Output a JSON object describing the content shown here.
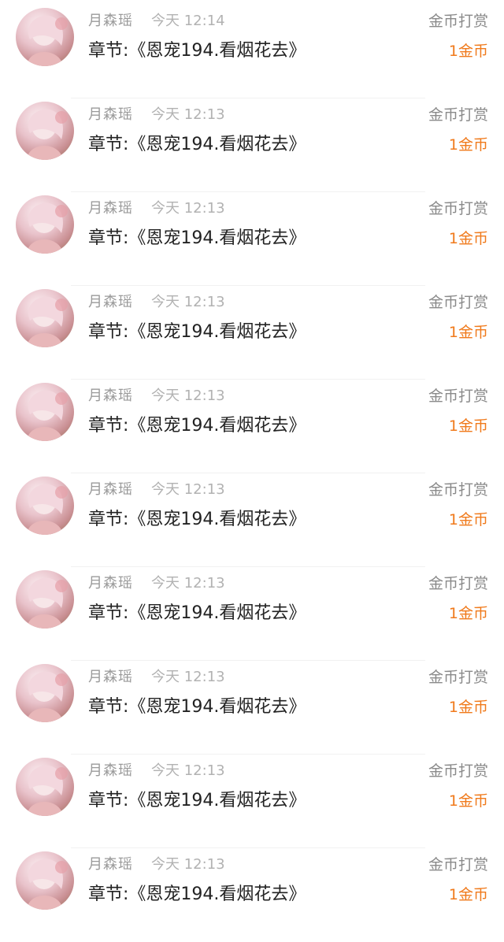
{
  "colors": {
    "name": "#9a9a9a",
    "time": "#b2b2b2",
    "chapter": "#222222",
    "type": "#8a8a8a",
    "amount": "#f07a1c"
  },
  "records": [
    {
      "user": "月森瑶",
      "time": "今天 12:14",
      "chapter": "章节:《恩宠194.看烟花去》",
      "type": "金币打赏",
      "amount": "1金币",
      "avatar_icon": "user-avatar-icon"
    },
    {
      "user": "月森瑶",
      "time": "今天 12:13",
      "chapter": "章节:《恩宠194.看烟花去》",
      "type": "金币打赏",
      "amount": "1金币",
      "avatar_icon": "user-avatar-icon"
    },
    {
      "user": "月森瑶",
      "time": "今天 12:13",
      "chapter": "章节:《恩宠194.看烟花去》",
      "type": "金币打赏",
      "amount": "1金币",
      "avatar_icon": "user-avatar-icon"
    },
    {
      "user": "月森瑶",
      "time": "今天 12:13",
      "chapter": "章节:《恩宠194.看烟花去》",
      "type": "金币打赏",
      "amount": "1金币",
      "avatar_icon": "user-avatar-icon"
    },
    {
      "user": "月森瑶",
      "time": "今天 12:13",
      "chapter": "章节:《恩宠194.看烟花去》",
      "type": "金币打赏",
      "amount": "1金币",
      "avatar_icon": "user-avatar-icon"
    },
    {
      "user": "月森瑶",
      "time": "今天 12:13",
      "chapter": "章节:《恩宠194.看烟花去》",
      "type": "金币打赏",
      "amount": "1金币",
      "avatar_icon": "user-avatar-icon"
    },
    {
      "user": "月森瑶",
      "time": "今天 12:13",
      "chapter": "章节:《恩宠194.看烟花去》",
      "type": "金币打赏",
      "amount": "1金币",
      "avatar_icon": "user-avatar-icon"
    },
    {
      "user": "月森瑶",
      "time": "今天 12:13",
      "chapter": "章节:《恩宠194.看烟花去》",
      "type": "金币打赏",
      "amount": "1金币",
      "avatar_icon": "user-avatar-icon"
    },
    {
      "user": "月森瑶",
      "time": "今天 12:13",
      "chapter": "章节:《恩宠194.看烟花去》",
      "type": "金币打赏",
      "amount": "1金币",
      "avatar_icon": "user-avatar-icon"
    },
    {
      "user": "月森瑶",
      "time": "今天 12:13",
      "chapter": "章节:《恩宠194.看烟花去》",
      "type": "金币打赏",
      "amount": "1金币",
      "avatar_icon": "user-avatar-icon"
    }
  ]
}
